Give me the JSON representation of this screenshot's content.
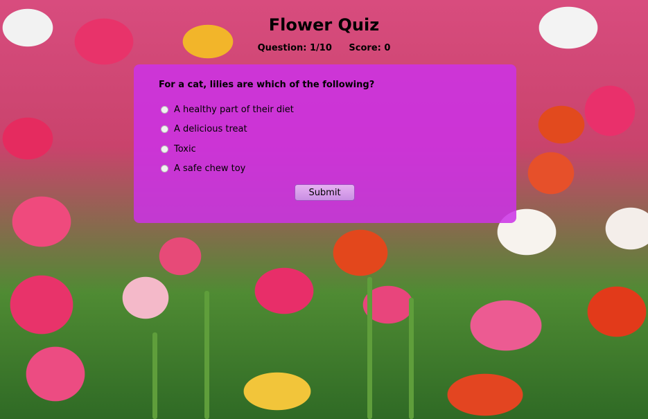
{
  "quiz": {
    "title": "Flower Quiz",
    "question_counter": "Question: 1/10",
    "score": "Score: 0",
    "question": "For a cat, lilies are which of the following?",
    "options": [
      {
        "label": "A healthy part of their diet"
      },
      {
        "label": "A delicious treat"
      },
      {
        "label": "Toxic"
      },
      {
        "label": "A safe chew toy"
      }
    ],
    "submit_label": "Submit"
  },
  "colors": {
    "card": "#cc32e6",
    "submit": "#d7a0ea"
  }
}
